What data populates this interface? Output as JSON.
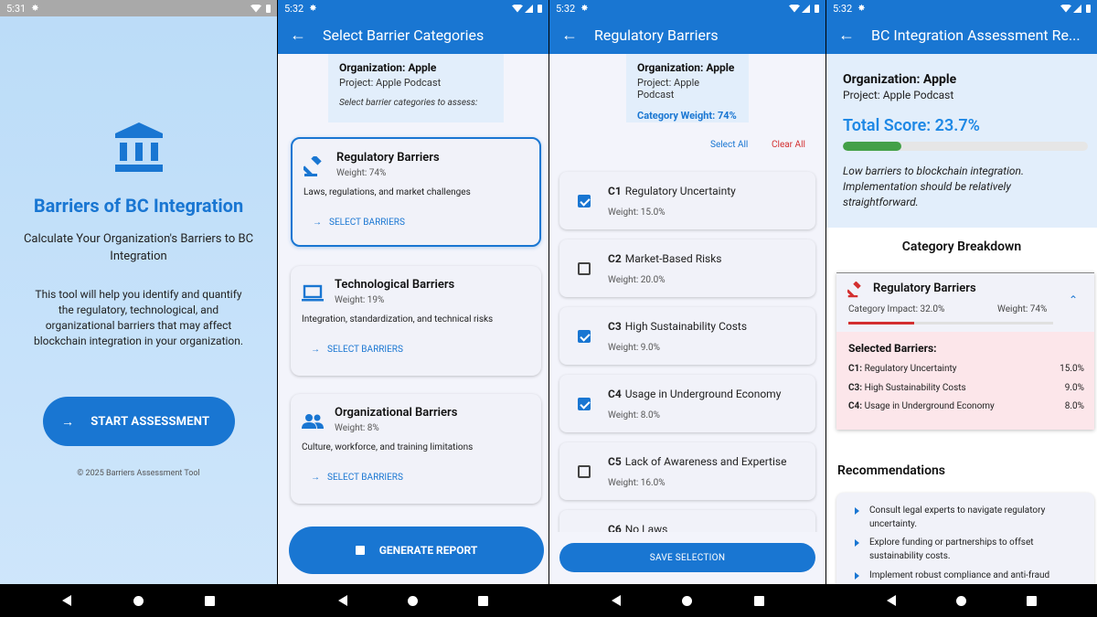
{
  "colors": {
    "primary": "#1976d2",
    "danger": "#d32f2f",
    "success": "#43a047"
  },
  "screen1": {
    "time": "5:31",
    "title": "Barriers of BC Integration",
    "subtitle": "Calculate Your Organization's Barriers to BC Integration",
    "description": "This tool will help you identify and quantify the regulatory, technological, and organizational barriers that may affect blockchain integration in your organization.",
    "start_label": "START ASSESSMENT",
    "copyright": "© 2025 Barriers Assessment Tool",
    "icon": "bank-icon"
  },
  "screen2": {
    "time": "5:32",
    "title": "Select Barrier Categories",
    "org": "Organization: Apple",
    "project": "Project: Apple Podcast",
    "hint": "Select barrier categories to assess:",
    "categories": [
      {
        "name": "Regulatory Barriers",
        "weight": "Weight: 74%",
        "desc": "Laws, regulations, and market challenges",
        "link": "SELECT BARRIERS",
        "icon": "gavel-icon"
      },
      {
        "name": "Technological Barriers",
        "weight": "Weight: 19%",
        "desc": "Integration, standardization, and technical risks",
        "link": "SELECT BARRIERS",
        "icon": "laptop-icon"
      },
      {
        "name": "Organizational Barriers",
        "weight": "Weight: 8%",
        "desc": "Culture, workforce, and training limitations",
        "link": "SELECT BARRIERS",
        "icon": "people-icon"
      }
    ],
    "generate_label": "GENERATE REPORT"
  },
  "screen3": {
    "time": "5:32",
    "title": "Regulatory Barriers",
    "org": "Organization: Apple",
    "project": "Project: Apple Podcast",
    "category_weight": "Category Weight: 74%",
    "select_all": "Select All",
    "clear_all": "Clear All",
    "barriers": [
      {
        "code": "C1",
        "name": "Regulatory Uncertainty",
        "weight": "Weight: 15.0%",
        "checked": true
      },
      {
        "code": "C2",
        "name": "Market-Based Risks",
        "weight": "Weight: 20.0%",
        "checked": false
      },
      {
        "code": "C3",
        "name": "High Sustainability Costs",
        "weight": "Weight: 9.0%",
        "checked": true
      },
      {
        "code": "C4",
        "name": "Usage in Underground Economy",
        "weight": "Weight: 8.0%",
        "checked": true
      },
      {
        "code": "C5",
        "name": "Lack of Awareness and Expertise",
        "weight": "Weight: 16.0%",
        "checked": false
      },
      {
        "code": "C6",
        "name": "No Laws",
        "weight": "",
        "checked": false
      }
    ],
    "save_label": "SAVE SELECTION"
  },
  "screen4": {
    "time": "5:32",
    "title": "BC Integration Assessment Re...",
    "org": "Organization: Apple",
    "project": "Project: Apple Podcast",
    "total_score": "Total Score: 23.7%",
    "score_fraction": 0.237,
    "note": "Low barriers to blockchain integration. Implementation should be relatively straightforward.",
    "breakdown_title": "Category Breakdown",
    "category": {
      "name": "Regulatory Barriers",
      "impact": "Category Impact: 32.0%",
      "impact_fraction": 0.32,
      "weight": "Weight: 74%",
      "selected_title": "Selected Barriers:",
      "selected": [
        {
          "code": "C1:",
          "name": "Regulatory Uncertainty",
          "value": "15.0%"
        },
        {
          "code": "C3:",
          "name": "High Sustainability Costs",
          "value": "9.0%"
        },
        {
          "code": "C4:",
          "name": "Usage in Underground Economy",
          "value": "8.0%"
        }
      ]
    },
    "recommendations_title": "Recommendations",
    "recommendations": [
      "Consult legal experts to navigate regulatory uncertainty.",
      "Explore funding or partnerships to offset sustainability costs.",
      "Implement robust compliance and anti-fraud"
    ]
  }
}
